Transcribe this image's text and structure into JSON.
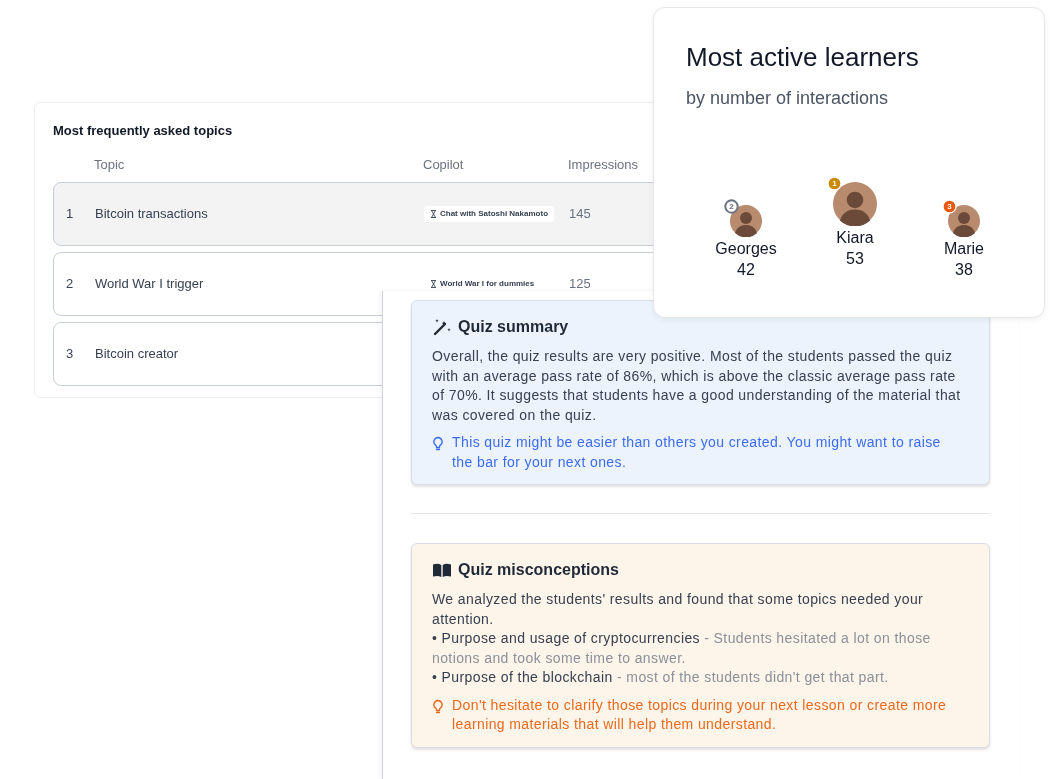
{
  "topics": {
    "title": "Most frequently asked topics",
    "columns": [
      "Topic",
      "Copilot",
      "Impressions"
    ],
    "rows": [
      {
        "number": "1",
        "topic": "Bitcoin transactions",
        "copilot": "Chat with Satoshi Nakamoto",
        "impressions": "145",
        "selected": true
      },
      {
        "number": "2",
        "topic": "World War I trigger",
        "copilot": "World War I for dummies",
        "impressions": "125",
        "selected": false
      },
      {
        "number": "3",
        "topic": "Bitcoin creator",
        "selected": false
      }
    ]
  },
  "learners": {
    "title": "Most active learners",
    "subtitle": "by number of interactions",
    "people": [
      {
        "rank": "2",
        "name": "Georges",
        "count": "42",
        "color": "#6b7280",
        "kind": "outline",
        "first": false
      },
      {
        "rank": "1",
        "name": "Kiara",
        "count": "53",
        "color": "#ca8a04",
        "kind": "filled",
        "first": true
      },
      {
        "rank": "3",
        "name": "Marie",
        "count": "38",
        "color": "#ea580c",
        "kind": "filled",
        "first": false
      }
    ]
  },
  "summary": {
    "title": "Quiz summary",
    "text": "Overall, the quiz results are very positive. Most of the students passed the quiz with an average pass rate of 86%, which is above the classic average pass rate of 70%. It suggests that students have a good understanding of the material that was covered on the quiz.",
    "tip": "This quiz might be easier than others you created. You might want to raise the bar for your next ones."
  },
  "misconceptions": {
    "title": "Quiz misconceptions",
    "text": "We analyzed the students' results and found that some topics needed your attention.",
    "items": [
      {
        "marker": "•",
        "topic": "Purpose and usage of cryptocurrencies",
        "note": "- Students hesitated a lot on those notions and took some time to answer."
      },
      {
        "marker": "•",
        "topic": "Purpose of the blockchain",
        "note": "- most of the students didn't get that part."
      }
    ],
    "tip": "Don't hesitate to clarify those topics during your next lesson or create more learning materials that will help them understand."
  }
}
